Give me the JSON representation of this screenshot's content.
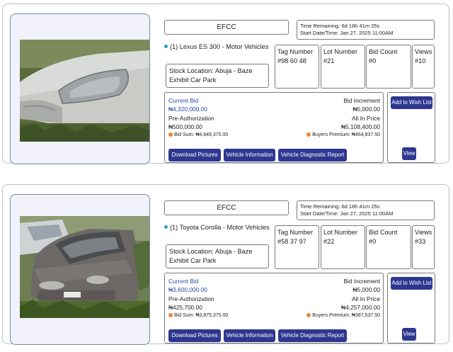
{
  "listings": [
    {
      "agency": "EFCC",
      "time_remaining": "Time Remaining: 6d 18h 41m 25s",
      "start_date": "Start Date/Time: Jan 27, 2025 11:00AM",
      "title": "(1) Lexus ES 300 - Motor Vehicles",
      "stock_location": "Stock Location: Abuja - Baze Exhibit Car Park",
      "tag_label": "Tag Number",
      "tag_value": "#98 60 48",
      "lot_label": "Lot Number",
      "lot_value": "#21",
      "bid_count_label": "Bid Count",
      "bid_count_value": "#0",
      "views_label": "Views",
      "views_value": "#10",
      "current_bid_label": "Current Bid",
      "current_bid_value": "₦4,320,000.00",
      "bid_increment_label": "Bid Increment",
      "bid_increment_value": "₦5,000.00",
      "preauth_label": "Pre-Authorization",
      "preauth_value": "₦500,000.00",
      "all_in_label": "All In Price",
      "all_in_value": "₦5,108,400.00",
      "bid_sum": "Bid Sum: ₦4,849,375.00",
      "buyers_premium": "Buyers Premium: ₦464,937.50",
      "btn_pictures": "Download Pictures",
      "btn_info": "Vehicle Information",
      "btn_diag": "Vehicle Diagnostic Report",
      "btn_wish": "Add to Wish List",
      "btn_view": "View",
      "car_color": "#c8cac6"
    },
    {
      "agency": "EFCC",
      "time_remaining": "Time Remaining: 6d 18h 41m 25s",
      "start_date": "Start Date/Time: Jan 27, 2025 11:00AM",
      "title": "(1) Toyota Corolla - Motor Vehicles",
      "stock_location": "Stock Location: Abuja - Baze Exhibit Car Park",
      "tag_label": "Tag Number",
      "tag_value": "#58 37 97",
      "lot_label": "Lot Number",
      "lot_value": "#22",
      "bid_count_label": "Bid Count",
      "bid_count_value": "#0",
      "views_label": "Views",
      "views_value": "#33",
      "current_bid_label": "Current Bid",
      "current_bid_value": "₦3,600,000.00",
      "bid_increment_label": "Bid Increment",
      "bid_increment_value": "₦5,000.00",
      "preauth_label": "Pre-Authorization",
      "preauth_value": "₦425,700.00",
      "all_in_label": "All In Price",
      "all_in_value": "₦4,257,000.00",
      "bid_sum": "Bid Sum: ₦3,875,375.00",
      "buyers_premium": "Buyers Premium: ₦387,537.50",
      "btn_pictures": "Download Pictures",
      "btn_info": "Vehicle Information",
      "btn_diag": "Vehicle Diagnostic Report",
      "btn_wish": "Add to Wish List",
      "btn_view": "View",
      "car_color": "#6f6b68"
    }
  ],
  "colors": {
    "button": "#2e3790",
    "link_blue": "#2b4aa8",
    "status_dot": "#1aa3c9",
    "orange_dot": "#e8873a"
  }
}
